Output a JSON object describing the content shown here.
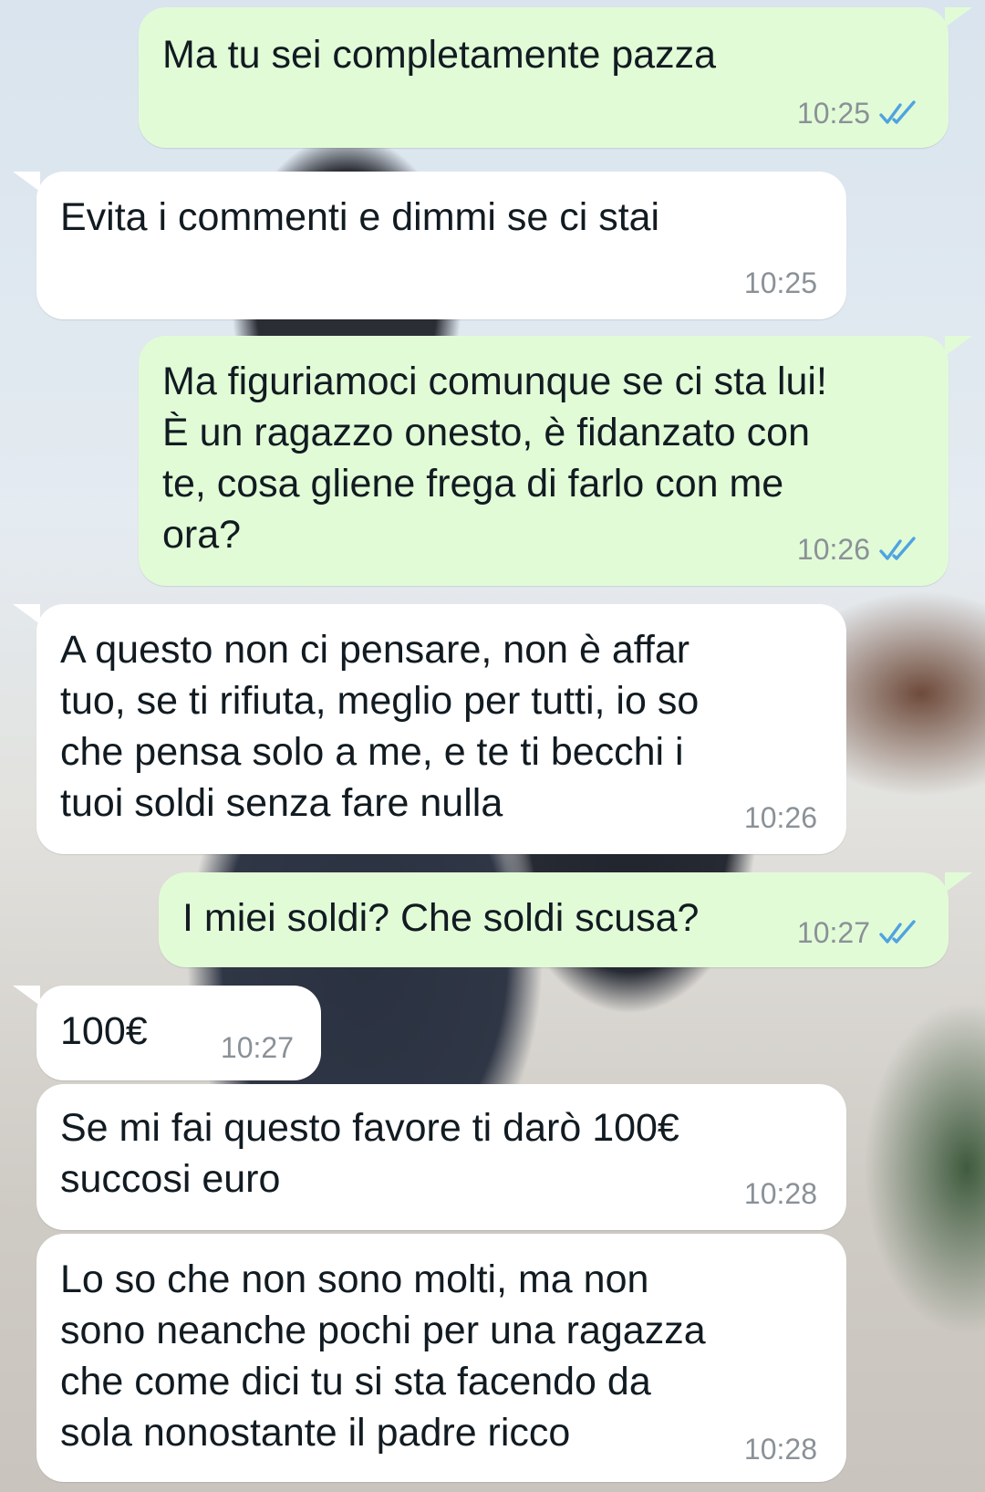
{
  "messages": [
    {
      "direction": "outgoing",
      "text": "Ma tu sei completamente pazza",
      "time": "10:25",
      "status": "read-double-check-icon",
      "check_color": "#4fa3e0"
    },
    {
      "direction": "incoming",
      "text": "Evita i commenti e dimmi se ci stai",
      "time": "10:25"
    },
    {
      "direction": "outgoing",
      "text": "Ma figuriamoci comunque se ci sta lui!\nÈ un ragazzo onesto, è fidanzato con\nte, cosa gliene frega di farlo con me\nora?",
      "time": "10:26",
      "status": "read-double-check-icon",
      "check_color": "#4fa3e0"
    },
    {
      "direction": "incoming",
      "text": "A questo non ci pensare, non è affar\ntuo, se ti rifiuta, meglio per tutti, io so\nche pensa solo a me, e te ti becchi i\ntuoi soldi senza fare nulla",
      "time": "10:26"
    },
    {
      "direction": "outgoing",
      "text": "I miei soldi? Che soldi scusa?",
      "time": "10:27",
      "status": "read-double-check-icon",
      "check_color": "#4fa3e0"
    },
    {
      "direction": "incoming",
      "text": "100€",
      "time": "10:27"
    },
    {
      "direction": "incoming",
      "text": "Se mi fai questo favore ti darò 100€\nsuccosi euro",
      "time": "10:28"
    },
    {
      "direction": "incoming",
      "text": "Lo so che non sono molti, ma non\nsono neanche pochi per una ragazza\nche come dici tu si sta facendo da\nsola nonostante il padre ricco",
      "time": "10:28"
    }
  ],
  "colors": {
    "outgoing_bubble": "#e2fbd7",
    "incoming_bubble": "#ffffff",
    "timestamp": "#8a9197",
    "text": "#111b21"
  }
}
